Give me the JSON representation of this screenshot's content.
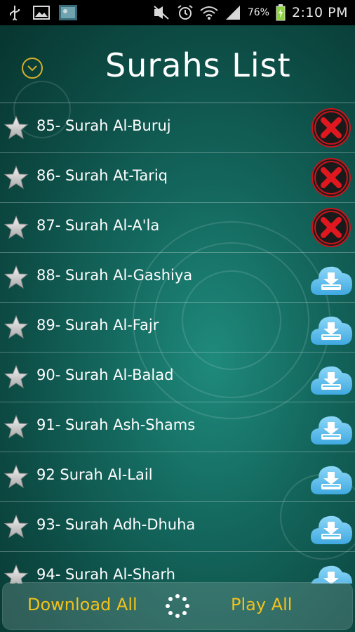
{
  "status_bar": {
    "battery_percent": "76%",
    "time": "2:10 PM",
    "icons": [
      "usb-icon",
      "gallery-icon",
      "media-thumbnail-icon",
      "mute-icon",
      "alarm-icon",
      "wifi-icon",
      "signal-icon",
      "battery-charging-icon"
    ]
  },
  "header": {
    "title": "Surahs List",
    "collapse_icon": "chevron-down-icon"
  },
  "surahs": [
    {
      "label": "85- Surah Al-Buruj",
      "action": "delete"
    },
    {
      "label": "86- Surah At-Tariq",
      "action": "delete"
    },
    {
      "label": "87- Surah Al-A'la",
      "action": "delete"
    },
    {
      "label": "88- Surah Al-Gashiya",
      "action": "download"
    },
    {
      "label": "89- Surah Al-Fajr",
      "action": "download"
    },
    {
      "label": "90- Surah Al-Balad",
      "action": "download"
    },
    {
      "label": "91- Surah Ash-Shams",
      "action": "download"
    },
    {
      "label": "92 Surah Al-Lail",
      "action": "download"
    },
    {
      "label": "93- Surah Adh-Dhuha",
      "action": "download"
    },
    {
      "label": "94- Surah Al-Sharh",
      "action": "download"
    }
  ],
  "bottom_bar": {
    "download_all": "Download All",
    "play_all": "Play All"
  },
  "colors": {
    "accent": "#f1c21b",
    "background": "#14685e",
    "delete_red": "#e0171f",
    "download_blue": "#5fc3ee"
  }
}
